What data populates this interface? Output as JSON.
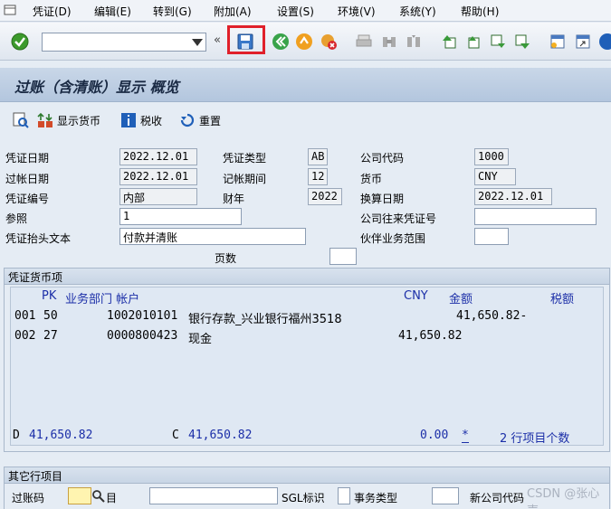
{
  "menu": {
    "items": [
      "凭证(D)",
      "编辑(E)",
      "转到(G)",
      "附加(A)",
      "设置(S)",
      "环境(V)",
      "系统(Y)",
      "帮助(H)"
    ]
  },
  "toolbar": {
    "command_value": ""
  },
  "title": "过账（含清账）显示 概览",
  "app_toolbar": {
    "display_currency": "显示货币",
    "tax": "税收",
    "reset": "重置"
  },
  "header": {
    "doc_date_label": "凭证日期",
    "doc_date": "2022.12.01",
    "doc_type_label": "凭证类型",
    "doc_type": "AB",
    "company_code_label": "公司代码",
    "company_code": "1000",
    "posting_date_label": "过帐日期",
    "posting_date": "2022.12.01",
    "period_label": "记帐期间",
    "period": "12",
    "currency_label": "货币",
    "currency": "CNY",
    "doc_no_label": "凭证编号",
    "doc_no": "内部",
    "fiscal_year_label": "财年",
    "fiscal_year": "2022",
    "translation_date_label": "换算日期",
    "translation_date": "2022.12.01",
    "reference_label": "参照",
    "reference": "1",
    "intercompany_label": "公司往来凭证号",
    "intercompany": "",
    "header_text_label": "凭证抬头文本",
    "header_text": "付款并清账",
    "partner_ba_label": "伙伴业务范围",
    "partner_ba": "",
    "pages_label": "页数",
    "pages": ""
  },
  "items_group": {
    "title": "凭证货币项",
    "headers": {
      "pk": "PK",
      "ba_account": "业务部门 帐户",
      "currency": "CNY",
      "amount": "金额",
      "tax": "税额"
    },
    "rows": [
      {
        "no": "001",
        "pk": "50",
        "account": "1002010101",
        "name": "银行存款_兴业银行福州3518",
        "debit": "",
        "credit": "41,650.82-"
      },
      {
        "no": "002",
        "pk": "27",
        "account": "0000800423",
        "name": "现金",
        "debit": "41,650.82",
        "credit": ""
      }
    ],
    "footer": {
      "d_label": "D",
      "d_value": "41,650.82",
      "c_label": "C",
      "c_value": "41,650.82",
      "balance": "0.00",
      "star": "*",
      "count_text": "2 行项目个数"
    }
  },
  "other_group": {
    "title": "其它行项目",
    "posting_key_label": "过账码",
    "account_suffix": "目",
    "sgl_label": "SGL标识",
    "trans_type_label": "事务类型",
    "new_cc_label": "新公司代码"
  },
  "watermark": "CSDN @张心声",
  "colors": {
    "highlight": "#e0202a",
    "list_blue": "#1c2fa8",
    "title_bg": "#b3c6de"
  }
}
